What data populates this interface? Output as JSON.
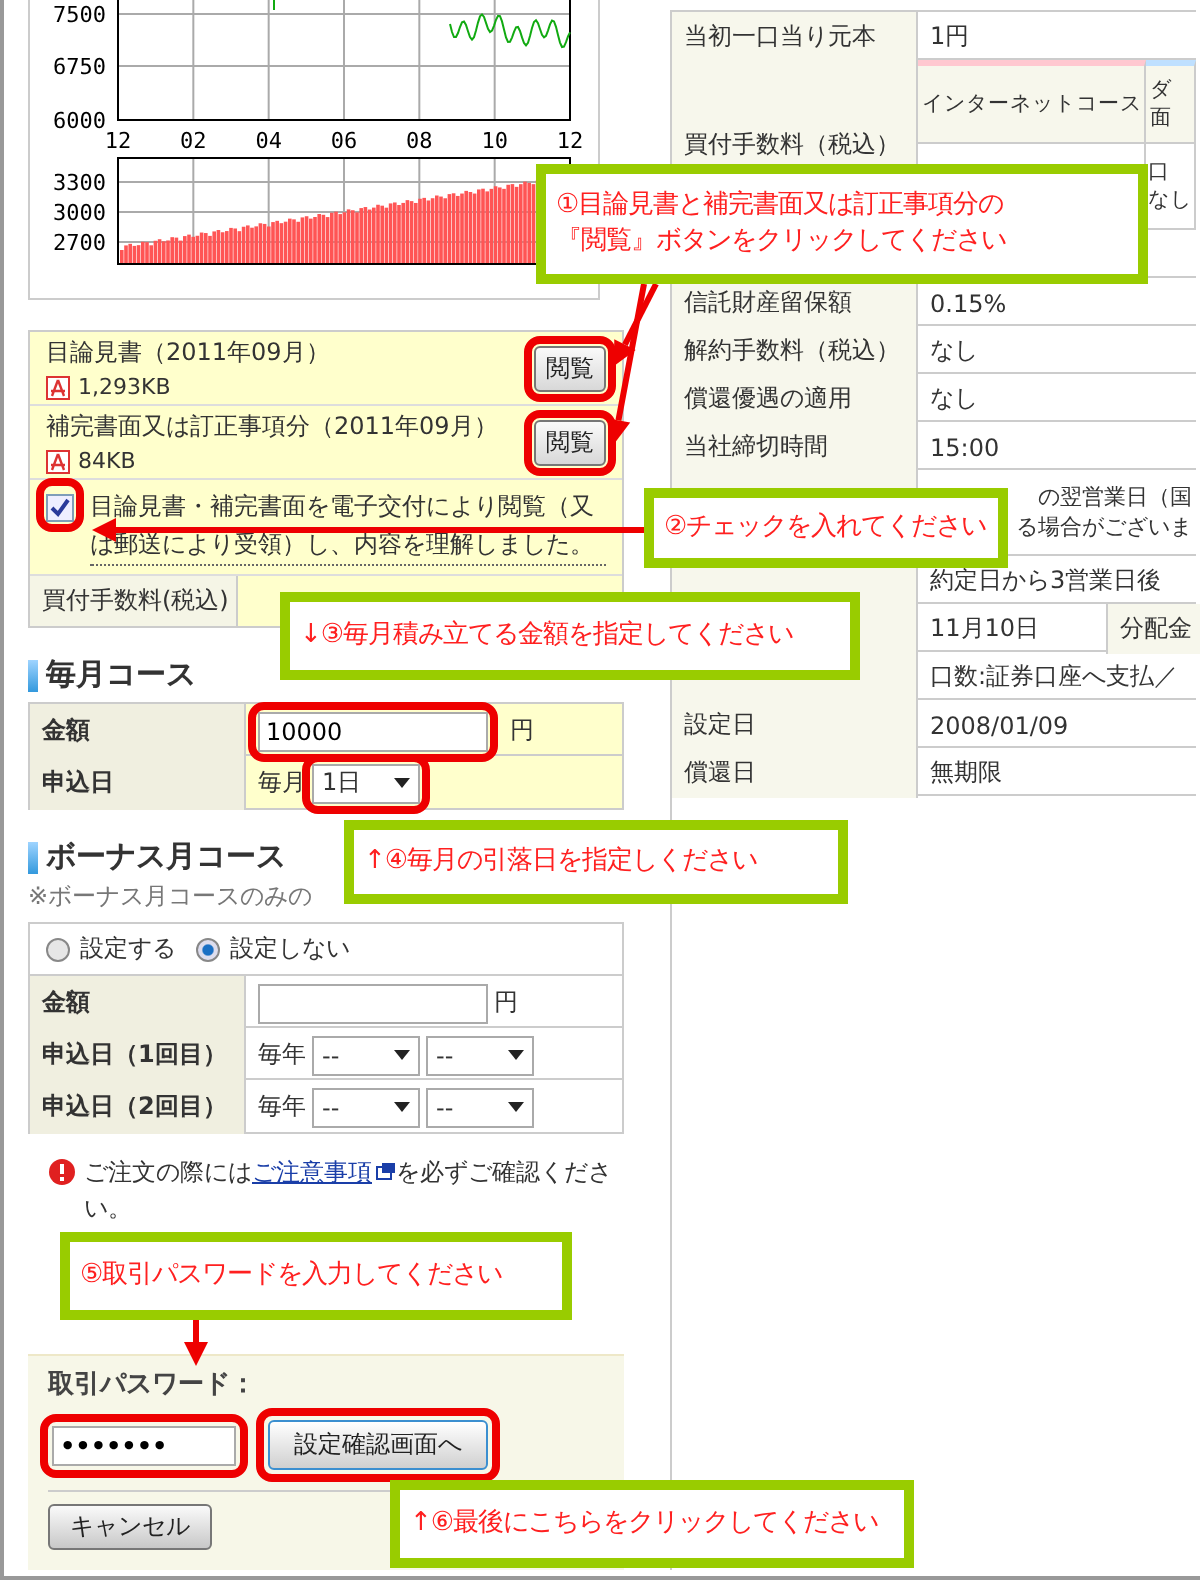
{
  "price_chart": {
    "y_labels": [
      "7500",
      "6750",
      "6000"
    ],
    "x_labels": [
      "12",
      "02",
      "04",
      "06",
      "08",
      "10",
      "12"
    ]
  },
  "volume_chart": {
    "y_labels": [
      "3300",
      "3000",
      "2700"
    ]
  },
  "documents": [
    {
      "title": "目論見書（2011年09月）",
      "size": "1,293KB",
      "button": "閲覧"
    },
    {
      "title": "補完書面又は訂正事項分（2011年09月）",
      "size": "84KB",
      "button": "閲覧"
    }
  ],
  "consent": {
    "checked": true,
    "text": "目論見書・補完書面を電子交付により閲覧（又は郵送により受領）し、内容を理解しました。"
  },
  "fee_row": {
    "label": "買付手数料(税込)"
  },
  "monthly": {
    "heading": "毎月コース",
    "amount_label": "金額",
    "amount_value": "10000",
    "unit": "円",
    "date_label": "申込日",
    "date_prefix": "毎月",
    "date_value": "1日"
  },
  "bonus": {
    "heading": "ボーナス月コース",
    "note": "※ボーナス月コースのみの",
    "options": [
      {
        "label": "設定する",
        "selected": false
      },
      {
        "label": "設定しない",
        "selected": true
      }
    ],
    "amount_label": "金額",
    "unit": "円",
    "dates": [
      {
        "label": "申込日（1回目）",
        "prefix": "毎年",
        "month": "--",
        "day": "--"
      },
      {
        "label": "申込日（2回目）",
        "prefix": "毎年",
        "month": "--",
        "day": "--"
      }
    ]
  },
  "notice": {
    "before": "ご注文の際には",
    "link": "ご注意事項",
    "after": "を必ずご確認ください。"
  },
  "password": {
    "label": "取引パスワード：",
    "value": "•••••••",
    "submit": "設定確認画面へ",
    "cancel": "キャンセル"
  },
  "fund_details": [
    {
      "kind": "simple",
      "label": "当初一口当り元本",
      "value": "1円"
    },
    {
      "kind": "fee",
      "label": "買付手数料（税込）",
      "header": "インターネットコース",
      "extra_header": [
        "ダ",
        "面"
      ],
      "extra_value": [
        "口",
        "なし"
      ]
    },
    {
      "kind": "blank"
    },
    {
      "kind": "simple",
      "label": "信託財産留保額",
      "value": "0.15%"
    },
    {
      "kind": "simple",
      "label": "解約手数料（税込）",
      "value": "なし"
    },
    {
      "kind": "simple",
      "label": "償還優遇の適用",
      "value": "なし"
    },
    {
      "kind": "simple",
      "label": "当社締切時間",
      "value": "15:00"
    },
    {
      "kind": "lines",
      "lines": [
        "の翌営業日（国",
        "る場合がございま"
      ]
    },
    {
      "kind": "simple",
      "value": "約定日から3営業日後"
    },
    {
      "kind": "split",
      "value": "11月10日",
      "extra": "分配金"
    },
    {
      "kind": "simple",
      "value": "口数:証券口座へ支払／"
    },
    {
      "kind": "simple",
      "label": "設定日",
      "value": "2008/01/09"
    },
    {
      "kind": "simple",
      "label": "償還日",
      "value": "無期限"
    }
  ],
  "annotations": [
    {
      "lines": [
        "①目論見書と補完書面又は訂正事項分の",
        "『閲覧』ボタンをクリックしてください"
      ]
    },
    {
      "lines": [
        "②チェックを入れてください"
      ]
    },
    {
      "lines": [
        "↓③毎月積み立てる金額を指定してください"
      ]
    },
    {
      "lines": [
        "↑④毎月の引落日を指定しください"
      ]
    },
    {
      "lines": [
        "⑤取引パスワードを入力してください"
      ]
    },
    {
      "lines": [
        "↑⑥最後にこちらをクリックしてください"
      ]
    }
  ]
}
